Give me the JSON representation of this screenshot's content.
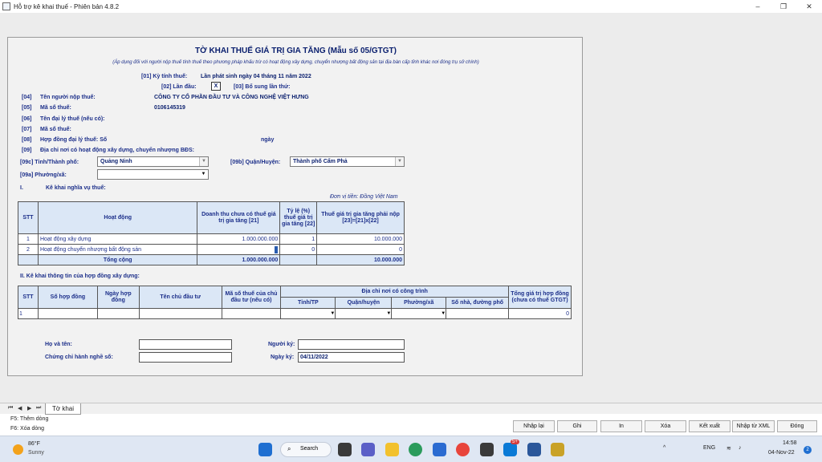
{
  "window": {
    "title": "Hỗ trợ kê khai thuế -  Phiên bản 4.8.2",
    "min": "–",
    "restore": "❐",
    "close": "✕"
  },
  "form": {
    "title": "TỜ KHAI THUẾ GIÁ TRỊ GIA TĂNG (Mẫu số 05/GTGT)",
    "subtitle": "(Áp dụng đối với người nộp thuế tính thuế theo phương pháp khấu trừ có hoạt động xây dựng, chuyển nhượng bất động sản tại địa bàn cấp tỉnh khác nơi đóng trụ sở chính)",
    "f01_label": "[01]  Kỳ tính thuế:",
    "f01_value": "Lần phát sinh ngày 04 tháng 11 năm 2022",
    "f02_label": "[02]   Lần đầu:",
    "f02_value": "X",
    "f03_label": "[03]  Bổ sung lần thứ:",
    "f04_code": "[04]",
    "f04_label": "Tên người nộp thuế:",
    "f04_value": "CÔNG TY CỔ PHẦN ĐẦU TƯ VÀ CÔNG NGHỆ VIỆT HƯNG",
    "f05_code": "[05]",
    "f05_label": "Mã số thuế:",
    "f05_value": "0106145319",
    "f06_code": "[06]",
    "f06_label": "Tên đại lý thuế (nếu có):",
    "f07_code": "[07]",
    "f07_label": "Mã số thuế:",
    "f08_code": "[08]",
    "f08_label": "Hợp đồng đại lý thuế: Số",
    "f08_date": "ngày",
    "f09_code": "[09]",
    "f09_label": "Địa chỉ nơi có hoạt động xây dựng, chuyển nhượng BĐS:",
    "f09c_label": "[09c]  Tỉnh/Thành phố:",
    "f09c_value": "Quảng Ninh",
    "f09b_label": "[09b]  Quận/Huyện:",
    "f09b_value": "Thành phố Cẩm Phả",
    "f09a_label": "[09a]  Phường/xã:",
    "f09a_value": "",
    "sec1_num": "I.",
    "sec1_label": "Kê khai nghĩa vụ thuế:",
    "unit": "Đơn vị tiền:  Đồng Việt Nam",
    "t1_headers": {
      "stt": "STT",
      "act": "Hoạt động",
      "c21": "Doanh thu chưa có thuế giá trị gia tăng [21]",
      "c22": "Tỷ lệ (%) thuế giá trị gia tăng [22]",
      "c23": "Thuế giá trị gia tăng phải nộp [23]=[21]x[22]"
    },
    "t1_rows": [
      {
        "stt": "1",
        "act": "Hoạt động xây dựng",
        "c21": "1.000.000.000",
        "c22": "1",
        "c23": "10.000.000"
      },
      {
        "stt": "2",
        "act": "Hoạt động chuyển nhượng bất động sản",
        "c21": "",
        "c22": "0",
        "c23": "0"
      }
    ],
    "t1_total": {
      "label": "Tổng cộng",
      "c21": "1.000.000.000",
      "c23": "10.000.000"
    },
    "sec2_label": "II. Kê khai thông tin của hợp đồng xây dựng:",
    "t2_headers": {
      "stt": "STT",
      "contract": "Số hợp đồng",
      "date": "Ngày hợp đồng",
      "owner": "Tên chủ đầu tư",
      "tax": "Mã số thuế của chủ đầu tư (nếu có)",
      "addr": "Địa chỉ nơi có công trình",
      "prov": "Tỉnh/TP",
      "dist": "Quận/huyện",
      "ward": "Phường/xã",
      "street": "Số nhà, đường phố",
      "total": "Tổng giá trị hợp đồng (chưa có thuế GTGT)"
    },
    "t2_row": {
      "stt": "1",
      "total": "0"
    },
    "name_label": "Họ và tên:",
    "cert_label": "Chứng chỉ hành nghề số:",
    "signer_label": "Người ký:",
    "signdate_label": "Ngày ký:",
    "signdate_value": "04/11/2022"
  },
  "sheet": {
    "tab": "Tờ khai",
    "nav": [
      "⏮",
      "◀",
      "▶",
      "⏭"
    ]
  },
  "hints": {
    "f5": "F5: Thêm dòng",
    "f6": "F6: Xóa dòng"
  },
  "buttons": {
    "add": "Nhập lại",
    "save": "Ghi",
    "print": "In",
    "del": "Xóa",
    "export": "Kết xuất",
    "import": "Nhập từ XML",
    "close": "Đóng"
  },
  "taskbar": {
    "temp": "86°F",
    "weather": "Sunny",
    "search": "Search",
    "lang": "ENG",
    "time": "14:58",
    "date": "04-Nov-22",
    "badge": "5+",
    "notif": "2"
  },
  "colors": {
    "label_blue": "#1c2f8a",
    "header_bg": "#dbe7f6",
    "form_bg": "#f2f2f2"
  }
}
